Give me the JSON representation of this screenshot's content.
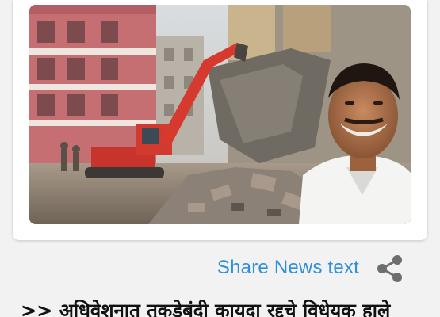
{
  "news_card": {
    "image_description_icon": "photo"
  },
  "share": {
    "label": "Share News text",
    "icon": "share-icon"
  },
  "article": {
    "text": ">> अधिवेशनात तुकडेबंदी कायदा रद्दचे विधेयक हाले"
  },
  "colors": {
    "share_text": "#2f8fd8",
    "share_icon": "#6e6e6e",
    "background": "#f2f2f2",
    "card": "#ffffff"
  }
}
